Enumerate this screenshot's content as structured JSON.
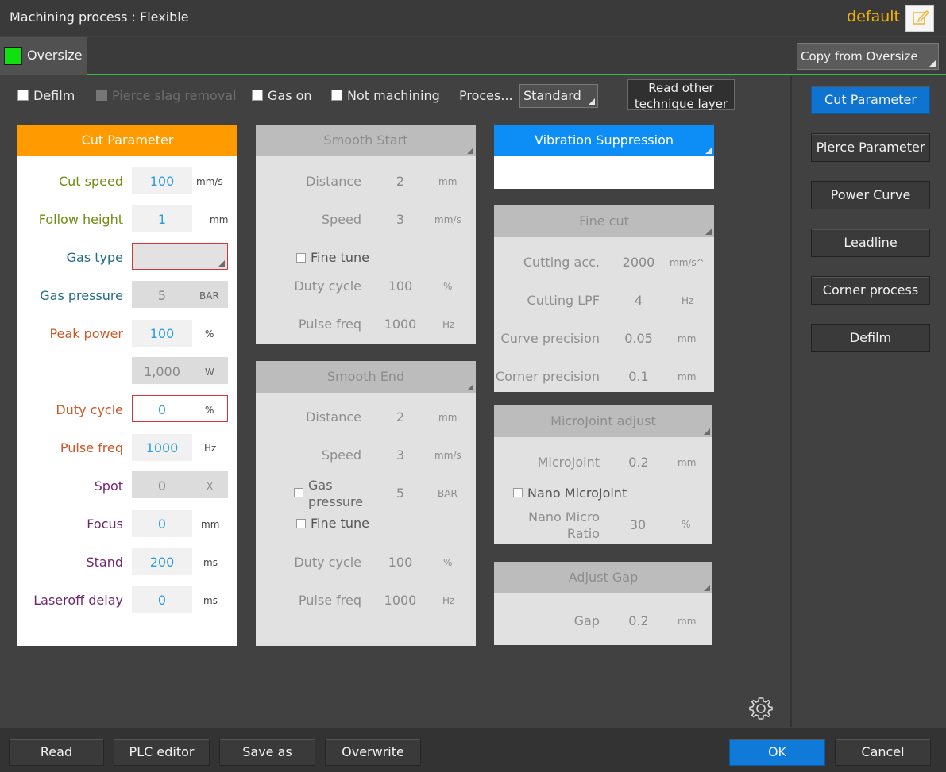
{
  "title": "Machining process : Flexible",
  "profile_name": "default",
  "layer": {
    "name": "Oversize",
    "color": "#10e010"
  },
  "copy_from_label": "Copy from Oversize",
  "options": {
    "defilm": "Defilm",
    "pierce_slag": "Pierce slag removal",
    "gas_on": "Gas on",
    "not_machining": "Not machining",
    "process_label": "Proces...",
    "process_value": "Standard",
    "read_other_line1": "Read other",
    "read_other_line2": "technique layer"
  },
  "cut_parameter": {
    "header": "Cut Parameter",
    "rows": [
      {
        "label": "Cut speed",
        "value": "100",
        "unit": "mm/s"
      },
      {
        "label": "Follow height",
        "value": "1",
        "unit": "mm"
      },
      {
        "label": "Gas type",
        "value": "",
        "unit": ""
      },
      {
        "label": "Gas pressure",
        "value": "5",
        "unit": "BAR"
      },
      {
        "label": "Peak power",
        "value": "100",
        "unit": "%"
      },
      {
        "label": "",
        "value": "1,000",
        "unit": "W"
      },
      {
        "label": "Duty cycle",
        "value": "0",
        "unit": "%"
      },
      {
        "label": "Pulse freq",
        "value": "1000",
        "unit": "Hz"
      },
      {
        "label": "Spot",
        "value": "0",
        "unit": "X"
      },
      {
        "label": "Focus",
        "value": "0",
        "unit": "mm"
      },
      {
        "label": "Stand",
        "value": "200",
        "unit": "ms"
      },
      {
        "label": "Laseroff delay",
        "value": "0",
        "unit": "ms"
      }
    ]
  },
  "smooth_start": {
    "header": "Smooth Start",
    "distance": {
      "label": "Distance",
      "value": "2",
      "unit": "mm"
    },
    "speed": {
      "label": "Speed",
      "value": "3",
      "unit": "mm/s"
    },
    "fine_tune": "Fine tune",
    "duty": {
      "label": "Duty cycle",
      "value": "100",
      "unit": "%"
    },
    "pulse": {
      "label": "Pulse freq",
      "value": "1000",
      "unit": "Hz"
    }
  },
  "smooth_end": {
    "header": "Smooth End",
    "distance": {
      "label": "Distance",
      "value": "2",
      "unit": "mm"
    },
    "speed": {
      "label": "Speed",
      "value": "3",
      "unit": "mm/s"
    },
    "gas_l1": "Gas",
    "gas_l2": "pressure",
    "gas_value": "5",
    "gas_unit": "BAR",
    "fine_tune": "Fine tune",
    "duty": {
      "label": "Duty cycle",
      "value": "100",
      "unit": "%"
    },
    "pulse": {
      "label": "Pulse freq",
      "value": "1000",
      "unit": "Hz"
    }
  },
  "vibration": {
    "header": "Vibration Suppression"
  },
  "fine_cut": {
    "header": "Fine cut",
    "rows": [
      {
        "label": "Cutting acc.",
        "value": "2000",
        "unit": "mm/s^"
      },
      {
        "label": "Cutting LPF",
        "value": "4",
        "unit": "Hz"
      },
      {
        "label": "Curve precision",
        "value": "0.05",
        "unit": "mm"
      },
      {
        "label": "Corner precision",
        "value": "0.1",
        "unit": "mm"
      }
    ]
  },
  "microjoint": {
    "header": "MicroJoint adjust",
    "mj": {
      "label": "MicroJoint",
      "value": "0.2",
      "unit": "mm"
    },
    "nano_check": "Nano MicroJoint",
    "ratio_l1": "Nano Micro",
    "ratio_l2": "Ratio",
    "ratio_value": "30",
    "ratio_unit": "%"
  },
  "adjust_gap": {
    "header": "Adjust Gap",
    "gap": {
      "label": "Gap",
      "value": "0.2",
      "unit": "mm"
    }
  },
  "side_nav": [
    "Cut Parameter",
    "Pierce Parameter",
    "Power Curve",
    "Leadline",
    "Corner process",
    "Defilm"
  ],
  "bottom": {
    "read": "Read",
    "plc": "PLC editor",
    "save_as": "Save as",
    "overwrite": "Overwrite",
    "ok": "OK",
    "cancel": "Cancel"
  }
}
